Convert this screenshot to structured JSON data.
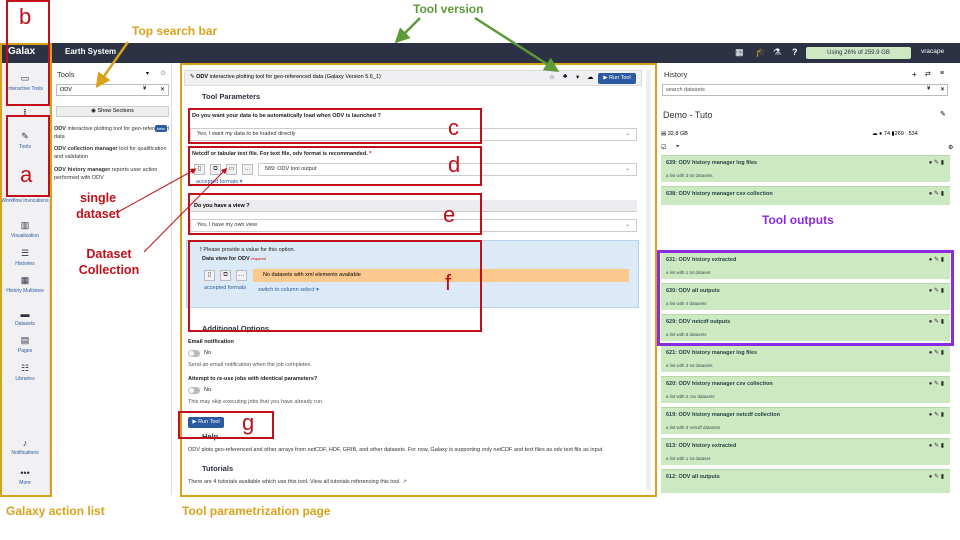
{
  "annotations": {
    "top_search_bar": "Top search bar",
    "tool_version": "Tool version",
    "single_dataset": "single\ndataset",
    "dataset_collection": "Dataset\nCollection",
    "tool_outputs": "Tool outputs",
    "galaxy_action_list": "Galaxy action list",
    "tool_parametrization": "Tool parametrization page",
    "letters": {
      "b": "b",
      "a": "a",
      "c": "c",
      "d": "d",
      "e": "e",
      "f": "f",
      "g": "g"
    }
  },
  "topbar": {
    "brand": "Galax",
    "title": "Earth System",
    "usage": "Using 26% of 259.9 GB",
    "user": "vracape"
  },
  "actions": [
    {
      "icon": "laptop-icon",
      "glyph": "▭",
      "label": "Interactive Tools"
    },
    {
      "icon": "upload-icon",
      "glyph": "⭱",
      "label": "Upload"
    },
    {
      "icon": "wrench-icon",
      "glyph": "🔧",
      "label": "Tools"
    },
    {
      "icon": "workflow-icon",
      "glyph": "⚙",
      "label": "Workflow Invocations"
    },
    {
      "icon": "chart-icon",
      "glyph": "▥",
      "label": "Visualization"
    },
    {
      "icon": "database-icon",
      "glyph": "☰",
      "label": "Histories"
    },
    {
      "icon": "columns-icon",
      "glyph": "▦",
      "label": "History Multiview"
    },
    {
      "icon": "folder-icon",
      "glyph": "▬",
      "label": "Datasets"
    },
    {
      "icon": "file-icon",
      "glyph": "▤",
      "label": "Pages"
    },
    {
      "icon": "library-icon",
      "glyph": "☷",
      "label": "Libraries"
    },
    {
      "icon": "bell-icon",
      "glyph": "🔔",
      "label": "Notifications"
    },
    {
      "icon": "more-icon",
      "glyph": "•••",
      "label": "More"
    }
  ],
  "tools_panel": {
    "title": "Tools",
    "search_value": "ODV",
    "show_sections": "Show Sections",
    "items": [
      {
        "name": "ODV",
        "desc": "interactive plotting tool for geo-referenced data",
        "badge": "beta"
      },
      {
        "name": "ODV collection manager",
        "desc": "tool for qualification and validation"
      },
      {
        "name": "ODV history manager",
        "desc": "reports user action performed with ODV"
      }
    ]
  },
  "form": {
    "header_name": "ODV",
    "header_desc": "interactive plotting tool for geo-referenced data (Galaxy Version 5.6_1)",
    "run_tool": "Run Tool",
    "params_title": "Tool Parameters",
    "q1_label": "Do you want your data to be automatically load when ODV is launched ?",
    "q1_value": "Yes, I want my data to be loaded directly",
    "q2_label": "Netcdf or tabular text file. For text file, odv format is recommanded.",
    "q2_value": "589: ODV tool output",
    "accepted_formats": "accepted formats ▾",
    "q3_label": "Do you have a view ?",
    "q3_value": "Yes, I have my own view",
    "warn": "Please provide a value for this option.",
    "data_view_label": "Data view for ODV",
    "required": "required",
    "no_datasets": "No datasets with xml elements available",
    "accepted_formats2": "accepted formats",
    "switch_column": "switch to column select ▾",
    "additional_options": "Additional Options",
    "email_label": "Email notification",
    "email_value": "No",
    "email_help": "Send an email notification when the job completes.",
    "reuse_label": "Attempt to re-use jobs with identical parameters?",
    "reuse_value": "No",
    "reuse_help": "This may skip executing jobs that you have already run.",
    "run_tool_bottom": "Run Tool",
    "help_title": "Help",
    "help_text": "ODV plots geo-referenced and other arrays from netCDF, HDF, GRIB, and other datasets. For now, Galaxy is supporting only netCDF and text files as odv text file as input.",
    "tutorials_title": "Tutorials",
    "tutorials_text": "There are 4 tutorials available which use this tool. View all tutorials referencing this tool."
  },
  "history": {
    "title": "History",
    "search_placeholder": "search datasets",
    "name": "Demo - Tuto",
    "size": "32.8 GB",
    "count_ok": "74",
    "count_deleted": "269",
    "count_hidden": "534",
    "items": [
      {
        "title": "639: ODV history manager log files",
        "sub": "a list with 3 txt datasets"
      },
      {
        "title": "638: ODV history manager csv collection",
        "sub": ""
      },
      {
        "title": "631: ODV history extracted",
        "sub": "a list with 1 txt dataset"
      },
      {
        "title": "630: ODV all outputs",
        "sub": "a list with 4 datasets"
      },
      {
        "title": "629: ODV netcdf outputs",
        "sub": "a list with 8 datasets"
      },
      {
        "title": "621: ODV history manager log files",
        "sub": "a list with 3 txt datasets"
      },
      {
        "title": "620: ODV history manager csv collection",
        "sub": "a list with 2 csv datasets"
      },
      {
        "title": "619: ODV history manager netcdf collection",
        "sub": "a list with 3 netcdf datasets"
      },
      {
        "title": "613: ODV history extracted",
        "sub": "a list with 1 txt dataset"
      },
      {
        "title": "612: ODV all outputs",
        "sub": ""
      }
    ]
  }
}
